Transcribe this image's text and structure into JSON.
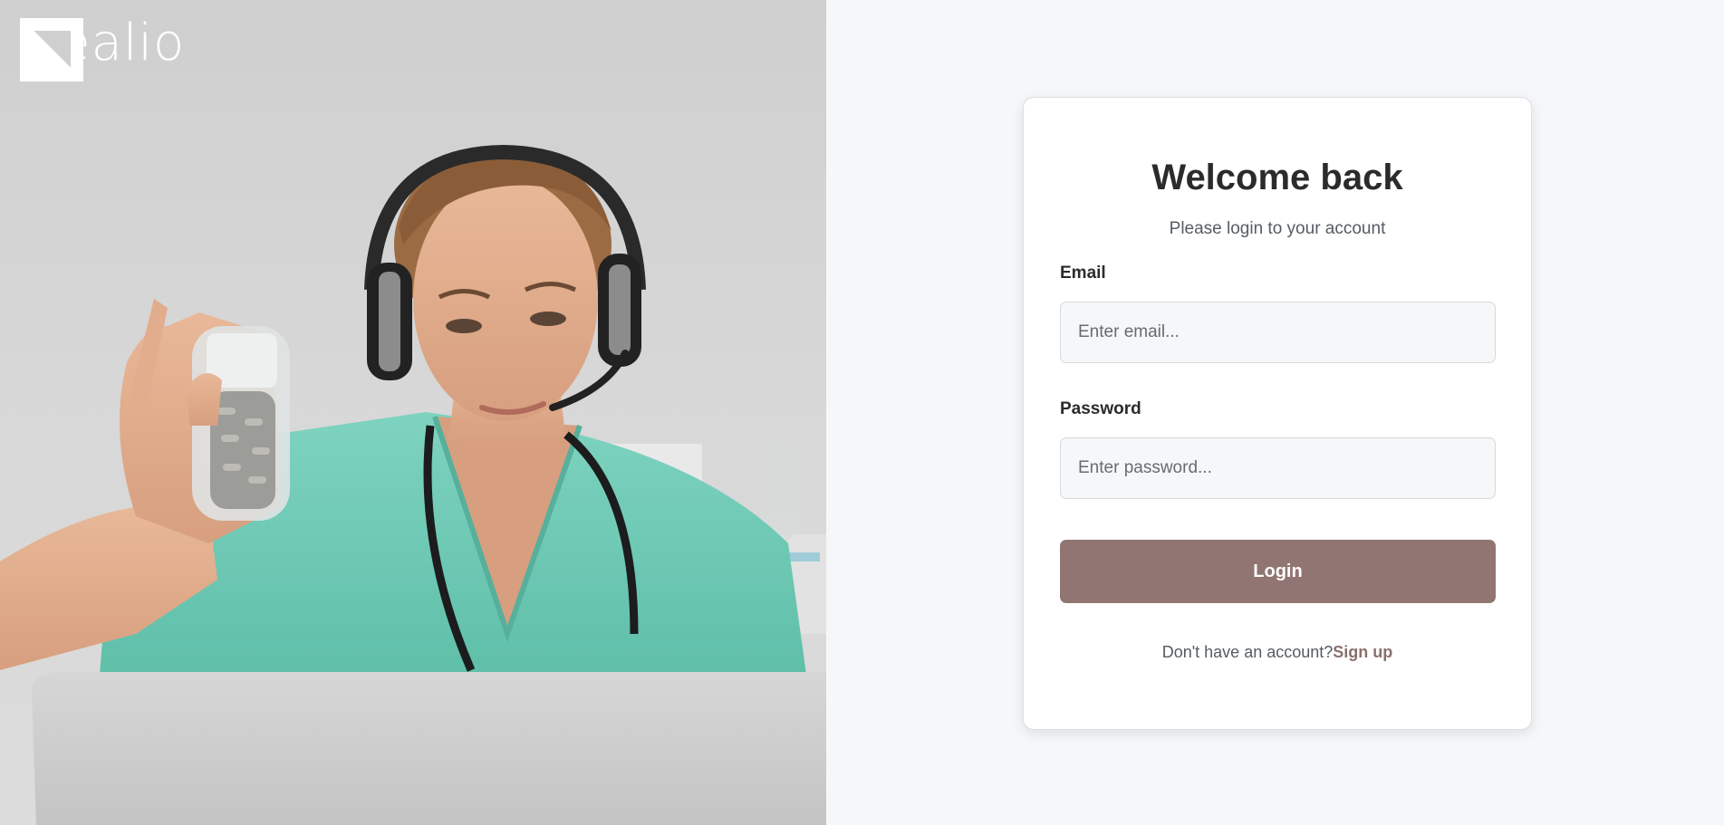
{
  "brand": {
    "name": "Healio"
  },
  "hero": {
    "image_alt": "Doctor wearing headset holding a pill bottle",
    "icon": "doctor-photo"
  },
  "login": {
    "title": "Welcome back",
    "subtitle": "Please login to your account",
    "email_label": "Email",
    "email_placeholder": "Enter email...",
    "email_value": "",
    "password_label": "Password",
    "password_placeholder": "Enter password...",
    "password_value": "",
    "submit_label": "Login",
    "signup_prompt": "Don't have an account?",
    "signup_link": "Sign up"
  },
  "colors": {
    "accent": "#917572",
    "link": "#8a706c",
    "background": "#f6f7f9",
    "card": "#ffffff"
  }
}
